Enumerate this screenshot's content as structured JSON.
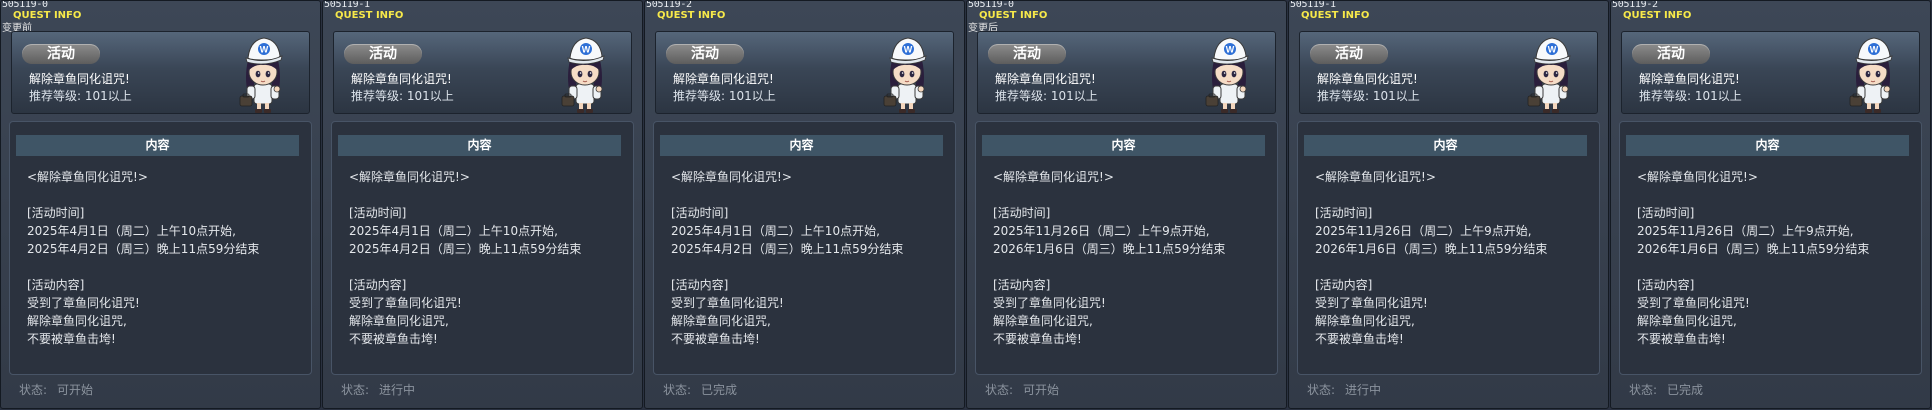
{
  "common": {
    "quest_label": "QUEST INFO",
    "badge": "活动",
    "quest_title": "解除章鱼同化诅咒!",
    "recommended_level": "推荐等级: 101以上",
    "content_header": "内容",
    "status_label": "状态:"
  },
  "panels": [
    {
      "id": "505119-0",
      "note": "变更前",
      "lines": [
        "<解除章鱼同化诅咒!>",
        "",
        "[活动时间]",
        "2025年4月1日（周二）上午10点开始,",
        "2025年4月2日（周三）晚上11点59分结束",
        "",
        "[活动内容]",
        "受到了章鱼同化诅咒!",
        "解除章鱼同化诅咒,",
        "不要被章鱼击垮!"
      ],
      "status": "可开始"
    },
    {
      "id": "505119-1",
      "note": "",
      "lines": [
        "<解除章鱼同化诅咒!>",
        "",
        "[活动时间]",
        "2025年4月1日（周二）上午10点开始,",
        "2025年4月2日（周三）晚上11点59分结束",
        "",
        "[活动内容]",
        "受到了章鱼同化诅咒!",
        "解除章鱼同化诅咒,",
        "不要被章鱼击垮!"
      ],
      "status": "进行中"
    },
    {
      "id": "505119-2",
      "note": "",
      "lines": [
        "<解除章鱼同化诅咒!>",
        "",
        "[活动时间]",
        "2025年4月1日（周二）上午10点开始,",
        "2025年4月2日（周三）晚上11点59分结束",
        "",
        "[活动内容]",
        "受到了章鱼同化诅咒!",
        "解除章鱼同化诅咒,",
        "不要被章鱼击垮!"
      ],
      "status": "已完成"
    },
    {
      "id": "505119-0",
      "note": "变更后",
      "lines": [
        "<解除章鱼同化诅咒!>",
        "",
        "[活动时间]",
        "2025年11月26日（周二）上午9点开始,",
        "2026年1月6日（周三）晚上11点59分结束",
        "",
        "[活动内容]",
        "受到了章鱼同化诅咒!",
        "解除章鱼同化诅咒,",
        "不要被章鱼击垮!"
      ],
      "status": "可开始"
    },
    {
      "id": "505119-1",
      "note": "",
      "lines": [
        "<解除章鱼同化诅咒!>",
        "",
        "[活动时间]",
        "2025年11月26日（周二）上午9点开始,",
        "2026年1月6日（周三）晚上11点59分结束",
        "",
        "[活动内容]",
        "受到了章鱼同化诅咒!",
        "解除章鱼同化诅咒,",
        "不要被章鱼击垮!"
      ],
      "status": "进行中"
    },
    {
      "id": "505119-2",
      "note": "",
      "lines": [
        "<解除章鱼同化诅咒!>",
        "",
        "[活动时间]",
        "2025年11月26日（周二）上午9点开始,",
        "2026年1月6日（周三）晚上11点59分结束",
        "",
        "[活动内容]",
        "受到了章鱼同化诅咒!",
        "解除章鱼同化诅咒,",
        "不要被章鱼击垮!"
      ],
      "status": "已完成"
    }
  ]
}
